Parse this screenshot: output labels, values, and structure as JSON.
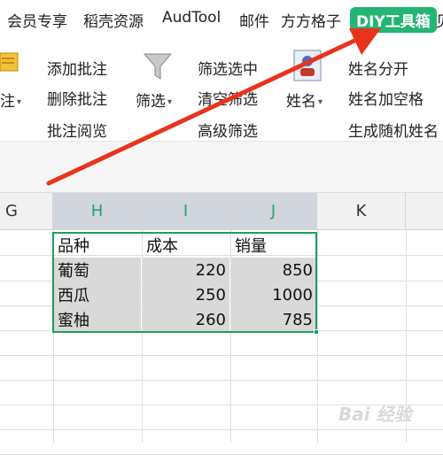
{
  "tabs": [
    "会员专享",
    "稻壳资源",
    "AudTool",
    "邮件",
    "方方格子",
    "DIY工具箱",
    "见"
  ],
  "ribbon": {
    "annot_partial": "注",
    "add_comment": "添加批注",
    "delete_comment": "删除批注",
    "read_comment": "批注阅览",
    "filter_label": "筛选",
    "filter_selected": "筛选选中",
    "clear_filter": "清空筛选",
    "advanced_filter": "高级筛选",
    "name_label": "姓名",
    "split_name": "姓名分开",
    "name_space": "姓名加空格",
    "random_name": "生成随机姓名"
  },
  "columns": [
    "G",
    "H",
    "I",
    "J",
    "K"
  ],
  "table": {
    "header": [
      "品种",
      "成本",
      "销量"
    ],
    "rows": [
      [
        "葡萄",
        "220",
        "850"
      ],
      [
        "西瓜",
        "250",
        "1000"
      ],
      [
        "蜜柚",
        "260",
        "785"
      ]
    ]
  },
  "colors": {
    "accent": "#22b573",
    "selection_border": "#1e9e62",
    "arrow": "#e8341c"
  },
  "watermark": "Bai 经验"
}
